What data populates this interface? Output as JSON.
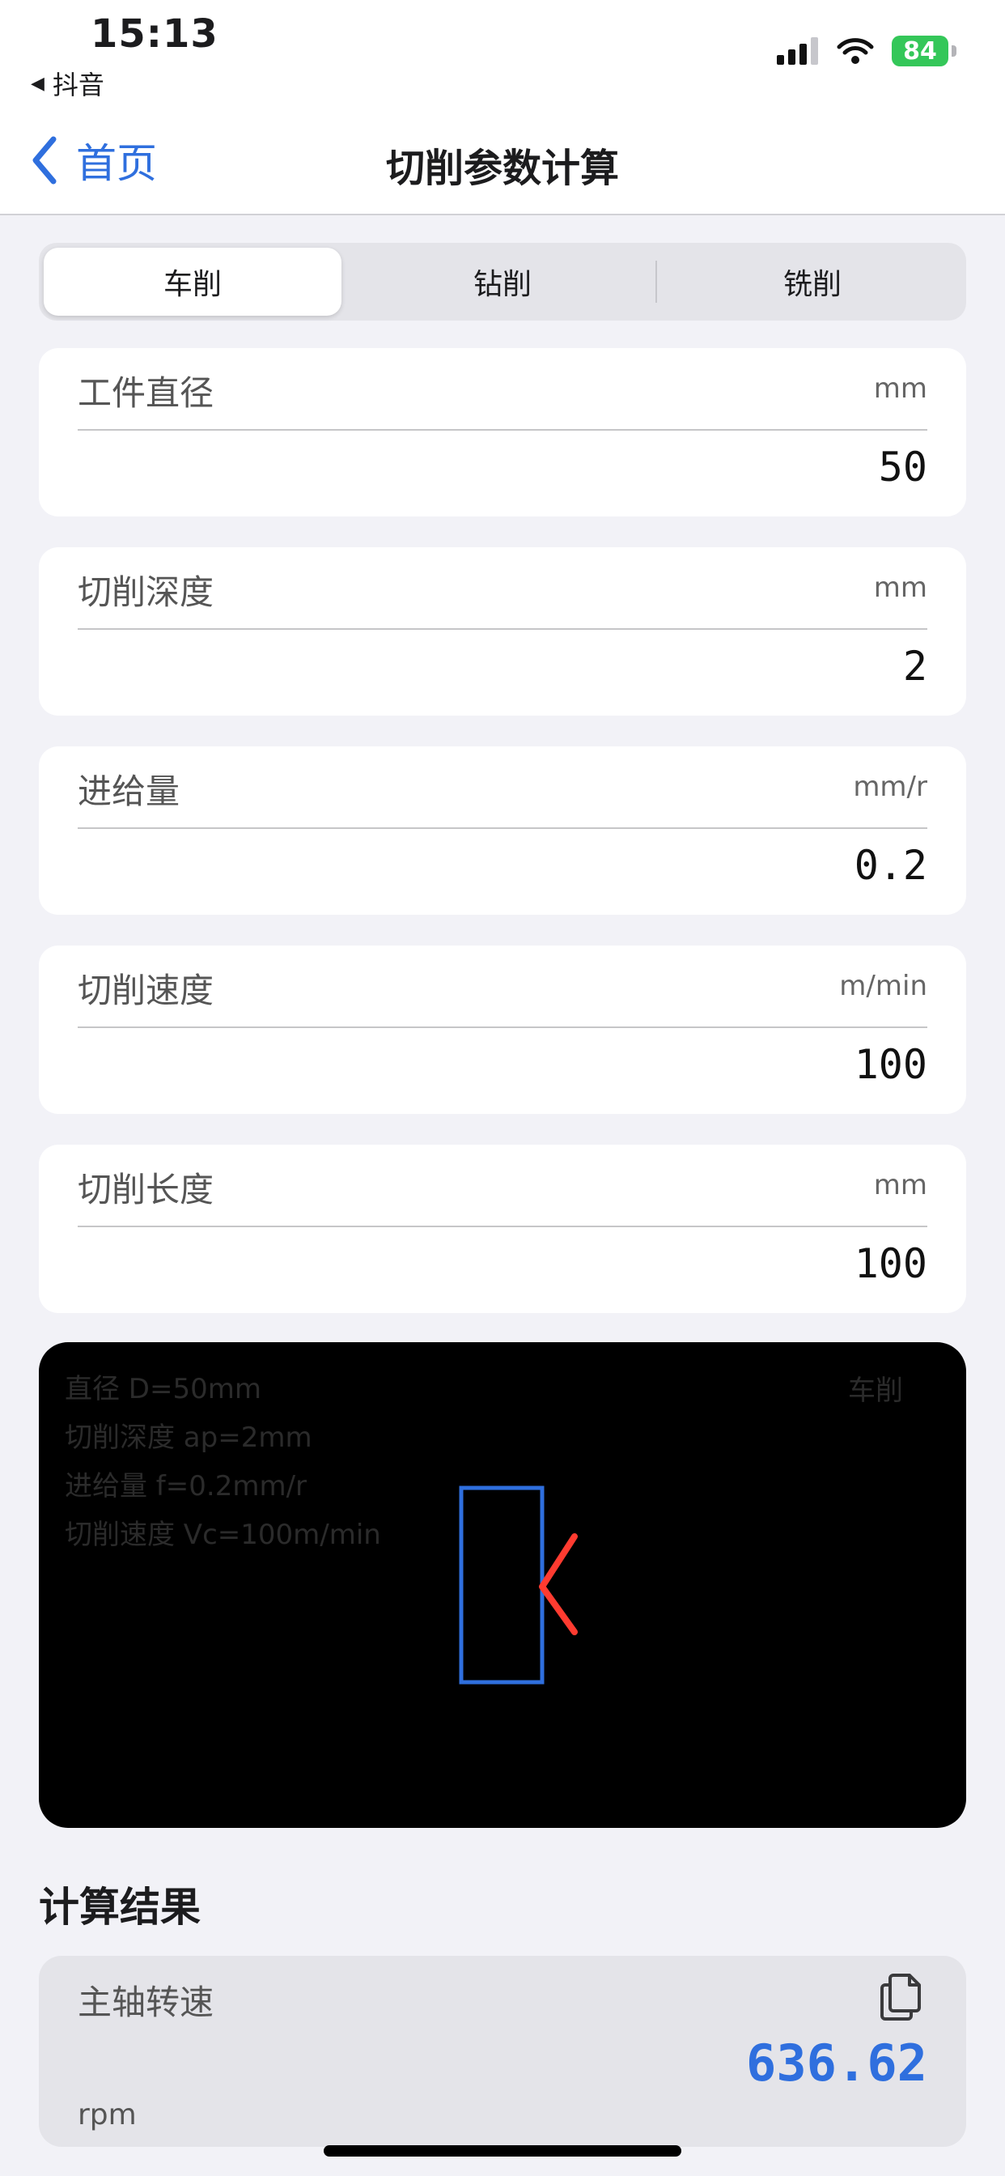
{
  "status_bar": {
    "time": "15:13",
    "back_app": "抖音",
    "battery": "84"
  },
  "nav": {
    "back_label": "首页",
    "title": "切削参数计算"
  },
  "segments": [
    "车削",
    "钻削",
    "铣削"
  ],
  "inputs": [
    {
      "label": "工件直径",
      "unit": "mm",
      "value": "50"
    },
    {
      "label": "切削深度",
      "unit": "mm",
      "value": "2"
    },
    {
      "label": "进给量",
      "unit": "mm/r",
      "value": "0.2"
    },
    {
      "label": "切削速度",
      "unit": "m/min",
      "value": "100"
    },
    {
      "label": "切削长度",
      "unit": "mm",
      "value": "100"
    }
  ],
  "diagram": {
    "lines": [
      "直径 D=50mm",
      "切削深度 ap=2mm",
      "进给量 f=0.2mm/r",
      "切削速度 Vc=100m/min"
    ],
    "mode": "车削",
    "workpiece_color": "#2f6fde",
    "tool_color": "#ff3b30"
  },
  "results": {
    "title": "计算结果",
    "spindle_label": "主轴转速",
    "spindle_value": "636.62",
    "spindle_unit": "rpm"
  },
  "colors": {
    "accent": "#2f6fde",
    "background": "#f2f2f7"
  }
}
